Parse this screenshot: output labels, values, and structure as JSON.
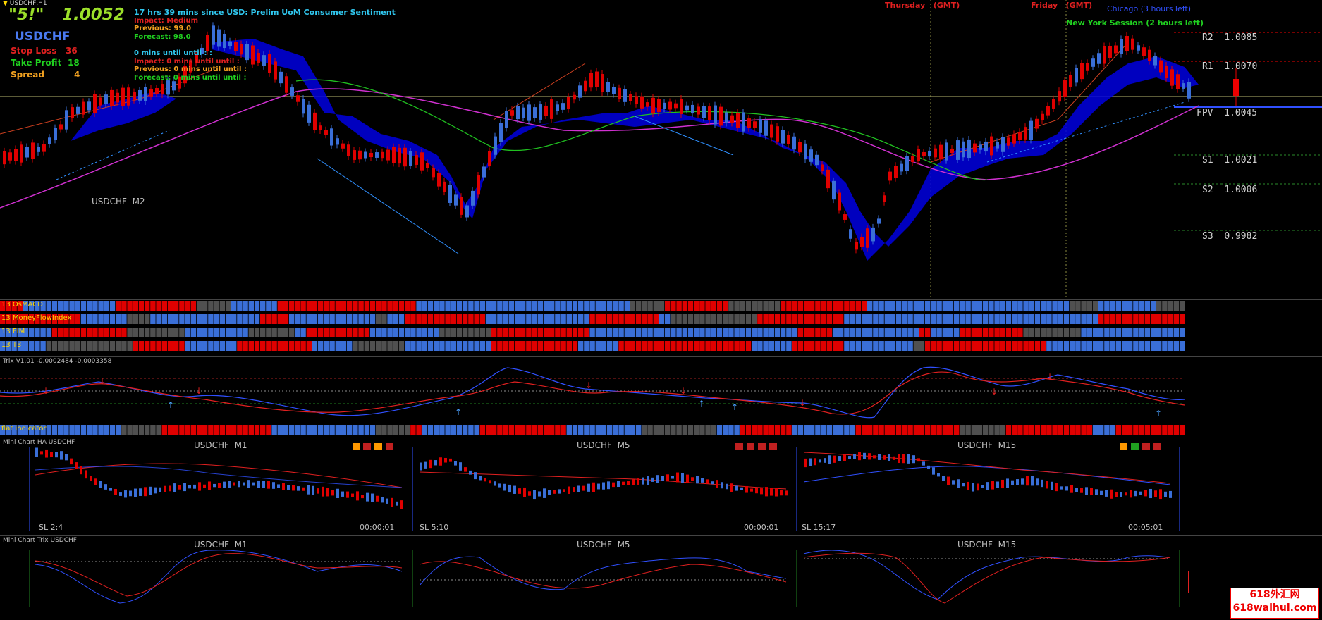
{
  "window": {
    "title": "USDCHF,H1"
  },
  "header": {
    "big_label": "\"5!\"",
    "big_price": "1.0052",
    "symbol": "USDCHF",
    "stop_loss_label": "Stop Loss",
    "stop_loss_value": "36",
    "take_profit_label": "Take Profit",
    "take_profit_value": "18",
    "spread_label": "Spread",
    "spread_value": "4"
  },
  "news": {
    "line1": "17 hrs 39 mins since USD: Prelim UoM Consumer Sentiment",
    "impact": "Impact: Medium",
    "previous": "Previous: 99.0",
    "forecast": "Forecast: 98.0",
    "line5": "0 mins until until : :",
    "line6": "Impact: 0 mins until until :",
    "line7": "Previous: 0 mins until until :",
    "line8": "Forecast: 0 mins until until :"
  },
  "sessions": {
    "thursday": "Thursday   (GMT)",
    "friday": "Friday   (GMT)",
    "chicago": "Chicago (3 hours left)",
    "newyork": "New York Session (2 hours left)"
  },
  "pivots": [
    {
      "label": "R2",
      "value": "1.0085"
    },
    {
      "label": "R1",
      "value": "1.0070"
    },
    {
      "label": "FPV",
      "value": "1.0045"
    },
    {
      "label": "S1",
      "value": "1.0021"
    },
    {
      "label": "S2",
      "value": "1.0006"
    },
    {
      "label": "S3",
      "value": "0.9982"
    }
  ],
  "main_chart_label": "USDCHF  M2",
  "indicator_rows": [
    "13 OsMACD",
    "13 MoneyFlowIndex",
    "13 FIM",
    "13 T3"
  ],
  "trix_label": "Trix V1.01 -0.0002484 -0.0003358",
  "flat_label": "flat indicator  ",
  "mini_ha": {
    "title": "Mini Chart HA USDCHF",
    "charts": [
      {
        "name": "USDCHF  M1",
        "sl": "SL 2:4",
        "time": "00:00:01"
      },
      {
        "name": "USDCHF  M5",
        "sl": "SL 5:10",
        "time": "00:00:01"
      },
      {
        "name": "USDCHF  M15",
        "sl": "SL 15:17",
        "time": "00:05:01"
      }
    ]
  },
  "mini_trix": {
    "title": "Mini Chart Trix USDCHF",
    "charts": [
      {
        "name": "USDCHF  M1"
      },
      {
        "name": "USDCHF  M5"
      },
      {
        "name": "USDCHF  M15"
      }
    ]
  },
  "watermark": {
    "line1": "618外汇网",
    "line2": "618waihui.com"
  },
  "colors": {
    "bull": "#3a6fd8",
    "bear": "#e00000",
    "neutral": "#505050"
  }
}
